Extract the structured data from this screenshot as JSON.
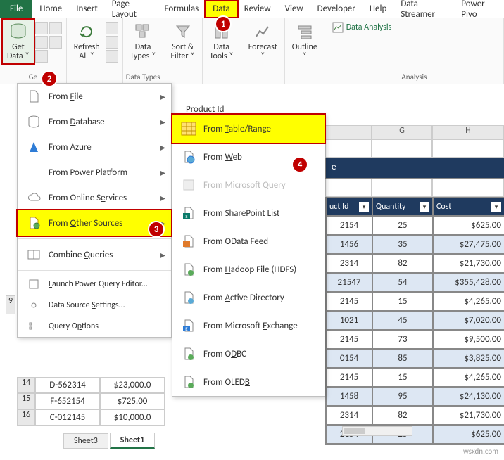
{
  "tabs": {
    "file": "File",
    "home": "Home",
    "insert": "Insert",
    "page_layout": "Page Layout",
    "formulas": "Formulas",
    "data": "Data",
    "review": "Review",
    "view": "View",
    "developer": "Developer",
    "help": "Help",
    "streamer": "Data Streamer",
    "pivot": "Power Pivo"
  },
  "ribbon": {
    "get_data": "Get\nData ˅",
    "refresh": "Refresh\nAll ˅",
    "data_types": "Data\nTypes ˅",
    "sort_filter": "Sort &\nFilter ˅",
    "data_tools": "Data\nTools ˅",
    "forecast": "Forecast\n˅",
    "outline": "Outline\n˅",
    "analysis_btn": "Data Analysis",
    "grp_get": "Ge",
    "grp_types": "Data Types",
    "grp_analysis": "Analysis"
  },
  "menu1": {
    "from_file": "From File",
    "from_database": "From Database",
    "from_azure": "From Azure",
    "from_power": "From Power Platform",
    "from_online": "From Online Services",
    "from_other": "From Other Sources",
    "combine": "Combine Queries",
    "launch_pq": "Launch Power Query Editor...",
    "ds_settings": "Data Source Settings...",
    "q_options": "Query Options"
  },
  "menu2": {
    "table_range": "From Table/Range",
    "web": "From Web",
    "ms_query": "From Microsoft Query",
    "sp_list": "From SharePoint List",
    "odata": "From OData Feed",
    "hdfs": "From Hadoop File (HDFS)",
    "ad": "From Active Directory",
    "exchange": "From Microsoft Exchange",
    "odbc": "From ODBC",
    "oledb": "From OLEDB"
  },
  "formula_cell": "Product Id",
  "cols": {
    "g": "G",
    "h": "H"
  },
  "remark": "e",
  "table": {
    "h1": "uct Id",
    "h2": "Quantity",
    "h3": "Cost",
    "rows": [
      {
        "id": "2154",
        "q": "25",
        "c": "$625.00"
      },
      {
        "id": "1456",
        "q": "35",
        "c": "$27,475.00"
      },
      {
        "id": "2314",
        "q": "82",
        "c": "$21,730.00"
      },
      {
        "id": "21547",
        "q": "54",
        "c": "$355,428.00"
      },
      {
        "id": "2145",
        "q": "15",
        "c": "$4,265.00"
      },
      {
        "id": "1021",
        "q": "45",
        "c": "$7,020.00"
      },
      {
        "id": "2145",
        "q": "73",
        "c": "$9,500.00"
      },
      {
        "id": "0154",
        "q": "85",
        "c": "$3,825.00"
      },
      {
        "id": "2145",
        "q": "15",
        "c": "$4,265.00"
      },
      {
        "id": "1458",
        "q": "95",
        "c": "$24,130.00"
      },
      {
        "id": "2314",
        "q": "82",
        "c": "$21,730.00"
      },
      {
        "id": "2154",
        "q": "25",
        "c": "$625.00"
      }
    ]
  },
  "left": {
    "r14": {
      "n": "14",
      "a": "D-562314",
      "b": "$23,000.0"
    },
    "r15": {
      "n": "15",
      "a": "F-652154",
      "b": "$725.00"
    },
    "r16": {
      "n": "16",
      "a": "C-012145",
      "b": "$10,000.0"
    }
  },
  "sheets": {
    "s3": "Sheet3",
    "s1": "Sheet1"
  },
  "callouts": {
    "c1": "1",
    "c2": "2",
    "c3": "3",
    "c4": "4"
  },
  "watermark": "wsxdn.com"
}
